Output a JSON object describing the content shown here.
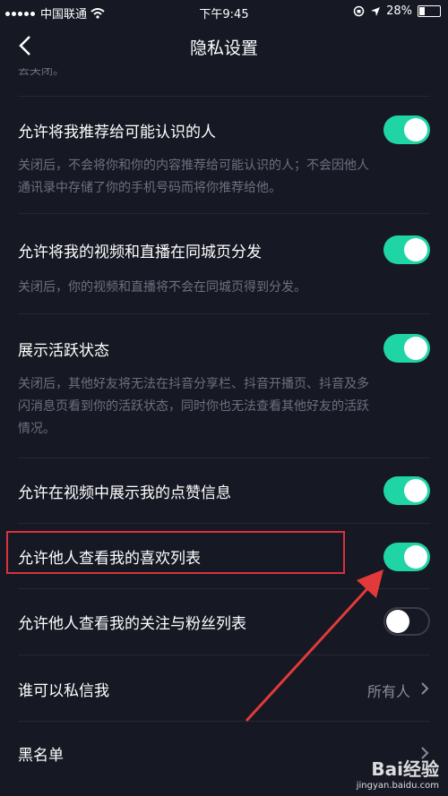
{
  "status_bar": {
    "carrier": "中国联通",
    "time": "下午9:45",
    "battery": "28%"
  },
  "header": {
    "title": "隐私设置"
  },
  "cut_text": "去关闭。",
  "settings": {
    "recommend": {
      "label": "允许将我推荐给可能认识的人",
      "desc_line1": "关闭后，不会将你和你的内容推荐给可能认识的人；不会因他人",
      "desc_line2": "通讯录中存储了你的手机号码而将你推荐给他。",
      "enabled": true
    },
    "same_city": {
      "label": "允许将我的视频和直播在同城页分发",
      "desc": "关闭后，你的视频和直播将不会在同城页得到分发。",
      "enabled": true
    },
    "active_status": {
      "label": "展示活跃状态",
      "desc_line1": "关闭后，其他好友将无法在抖音分享栏、抖音开播页、抖音及多",
      "desc_line2": "闪消息页看到你的活跃状态，同时你也无法查看其他好友的活跃",
      "desc_line3": "情况。",
      "enabled": true
    },
    "show_likes": {
      "label": "允许在视频中展示我的点赞信息",
      "enabled": true
    },
    "liked_list": {
      "label": "允许他人查看我的喜欢列表",
      "enabled": true
    },
    "follow_list": {
      "label": "允许他人查看我的关注与粉丝列表",
      "enabled": false
    },
    "private_message": {
      "label": "谁可以私信我",
      "value": "所有人"
    },
    "blacklist": {
      "label": "黑名单"
    }
  },
  "watermark": {
    "brand": "Bai经验",
    "url": "jingyan.baidu.com"
  },
  "colors": {
    "background": "#161823",
    "toggle_on": "#20d5a5",
    "annotation_red": "#d8323a"
  }
}
